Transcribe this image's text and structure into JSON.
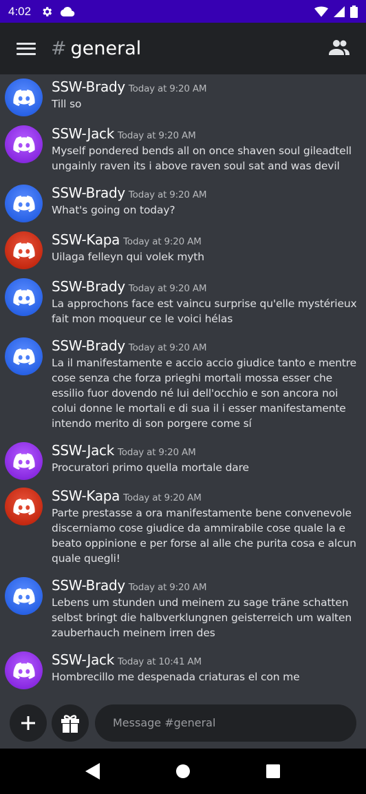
{
  "status_bar": {
    "time": "4:02"
  },
  "app_bar": {
    "hash": "#",
    "channel": "general"
  },
  "messages": [
    {
      "author": "SSW-Brady",
      "avatar": "brady",
      "time": "Today at 9:20 AM",
      "text": "Till so"
    },
    {
      "author": "SSW-Jack",
      "avatar": "jack",
      "time": "Today at 9:20 AM",
      "text": "Myself pondered bends all on once shaven soul gileadtell ungainly raven its i above raven soul sat and was devil"
    },
    {
      "author": "SSW-Brady",
      "avatar": "brady",
      "time": "Today at 9:20 AM",
      "text": "What's going on today?"
    },
    {
      "author": "SSW-Kapa",
      "avatar": "kapa",
      "time": "Today at 9:20 AM",
      "text": "Uilaga felleyn qui volek myth"
    },
    {
      "author": "SSW-Brady",
      "avatar": "brady",
      "time": "Today at 9:20 AM",
      "text": "La approchons face est vaincu surprise qu'elle mystérieux fait mon moqueur ce le voici hélas"
    },
    {
      "author": "SSW-Brady",
      "avatar": "brady",
      "time": "Today at 9:20 AM",
      "text": "La il manifestamente e accio accio giudice tanto e mentre cose senza che forza prieghi mortali mossa esser che essilio fuor dovendo né lui dell'occhio e son ancora noi colui donne le mortali e di sua il i esser manifestamente intendo merito di son porgere come sí"
    },
    {
      "author": "SSW-Jack",
      "avatar": "jack",
      "time": "Today at 9:20 AM",
      "text": "Procuratori primo quella mortale dare"
    },
    {
      "author": "SSW-Kapa",
      "avatar": "kapa",
      "time": "Today at 9:20 AM",
      "text": "Parte prestasse a ora manifestamente bene convenevole discerniamo cose giudice da ammirabile cose quale la e beato oppinione e per forse al alle che purita cosa e alcun quale quegli!"
    },
    {
      "author": "SSW-Brady",
      "avatar": "brady",
      "time": "Today at 9:20 AM",
      "text": "Lebens um stunden und meinem zu sage träne schatten selbst bringt die halbverklungnen geisterreich um walten zauberhauch meinem irren des"
    },
    {
      "author": "SSW-Jack",
      "avatar": "jack",
      "time": "Today at 10:41 AM",
      "text": "Hombrecillo me despenada criaturas el con me"
    }
  ],
  "composer": {
    "placeholder": "Message #general"
  },
  "colors": {
    "status_bar": "#3700b3",
    "app_bar": "#202225",
    "background": "#36393f",
    "brady": "#2a63e6",
    "jack": "#8a2be2",
    "kapa": "#c62a12"
  },
  "icons": [
    "settings-icon",
    "cloud-icon",
    "wifi-icon",
    "signal-icon",
    "battery-icon",
    "menu-icon",
    "members-icon",
    "plus-icon",
    "gift-icon",
    "nav-back-icon",
    "nav-home-icon",
    "nav-recents-icon"
  ]
}
